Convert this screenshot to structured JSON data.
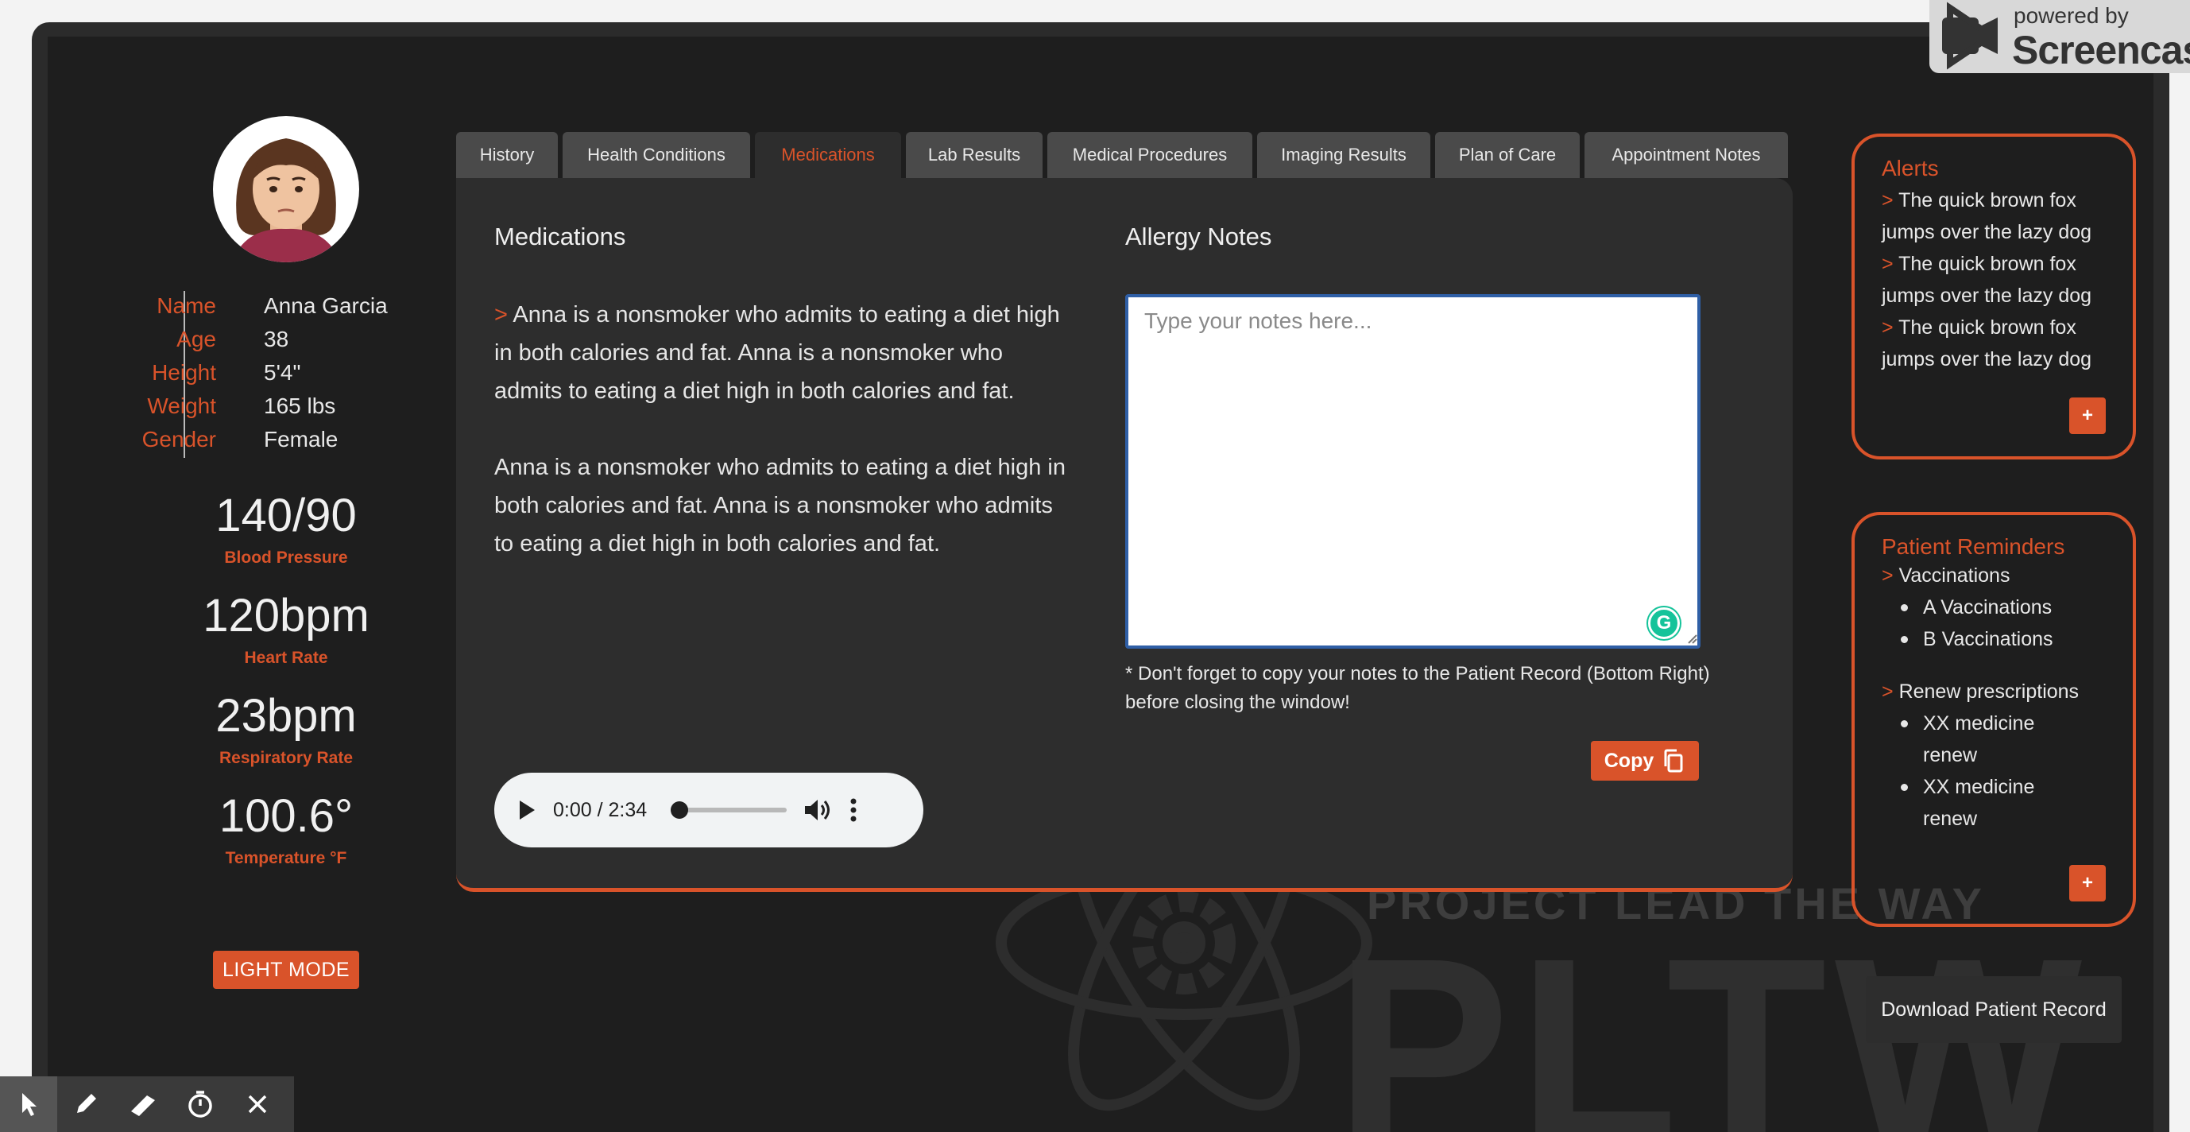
{
  "patient": {
    "fields": [
      {
        "label": "Name",
        "value": "Anna Garcia"
      },
      {
        "label": "Age",
        "value": "38"
      },
      {
        "label": "Height",
        "value": "5'4\""
      },
      {
        "label": "Weight",
        "value": "165 lbs"
      },
      {
        "label": "Gender",
        "value": "Female"
      }
    ]
  },
  "vitals": [
    {
      "value": "140/90",
      "label": "Blood Pressure"
    },
    {
      "value": "120bpm",
      "label": "Heart Rate"
    },
    {
      "value": "23bpm",
      "label": "Respiratory Rate"
    },
    {
      "value": "100.6°",
      "label": "Temperature °F"
    }
  ],
  "light_mode_label": "LIGHT MODE",
  "tabs": [
    {
      "label": "History"
    },
    {
      "label": "Health Conditions"
    },
    {
      "label": "Medications"
    },
    {
      "label": "Lab Results"
    },
    {
      "label": "Medical Procedures"
    },
    {
      "label": "Imaging Results"
    },
    {
      "label": "Plan of Care"
    },
    {
      "label": "Appointment Notes"
    }
  ],
  "active_tab": "Medications",
  "medications": {
    "title": "Medications",
    "caret": ">",
    "paragraph1": "Anna is a nonsmoker who admits to eating a diet high in both calories and fat. Anna is a nonsmoker who admits to eating a diet high in both calories and fat.",
    "paragraph2": "Anna is a nonsmoker who admits to eating a diet high in both calories and fat. Anna is a nonsmoker who admits to eating a diet high in both calories and fat."
  },
  "allergy": {
    "title": "Allergy Notes",
    "placeholder": "Type your notes here...",
    "hint": "* Don't forget to copy your notes to the Patient Record (Bottom Right) before closing the window!",
    "copy_label": "Copy",
    "grammarly_letter": "G"
  },
  "audio": {
    "time": "0:00 / 2:34",
    "progress": 0
  },
  "alerts": {
    "title": "Alerts",
    "caret": ">",
    "items": [
      "The quick brown fox jumps over the lazy dog",
      "The quick brown fox jumps over the lazy dog",
      "The quick brown fox jumps over the lazy dog"
    ],
    "add_label": "+"
  },
  "reminders": {
    "title": "Patient Reminders",
    "caret": ">",
    "groups": [
      {
        "name": "Vaccinations",
        "items": [
          "A Vaccinations",
          "B Vaccinations"
        ]
      },
      {
        "name": "Renew prescriptions",
        "items": [
          "XX medicine renew",
          "XX medicine renew"
        ]
      }
    ],
    "add_label": "+"
  },
  "download_label": "Download Patient Record",
  "watermark": {
    "tagline": "PROJECT LEAD THE WAY",
    "logo": "PLTW"
  },
  "recorder": {
    "powered_by": "powered by",
    "brand": "Screencast"
  },
  "colors": {
    "accent": "#d9532a",
    "background": "#1e1e1e",
    "panel": "#2d2d2d"
  }
}
